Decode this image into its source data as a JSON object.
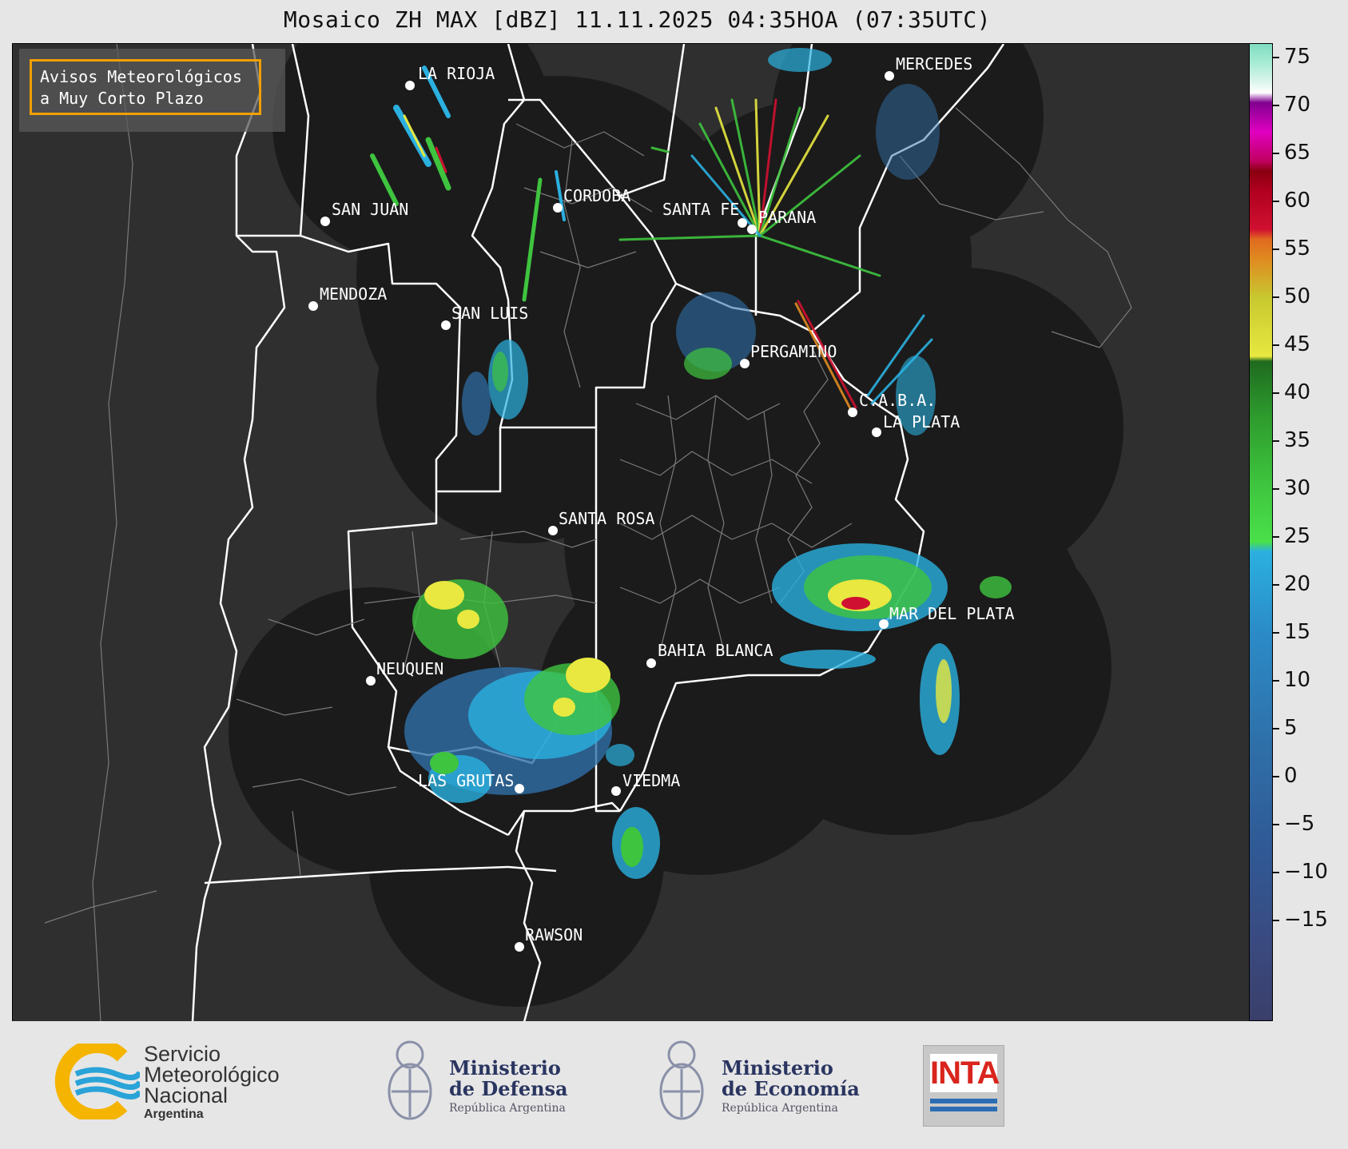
{
  "title": "Mosaico ZH MAX [dBZ] 11.11.2025 04:35HOA (07:35UTC)",
  "notice": {
    "line1": "Avisos Meteorológicos",
    "line2": "a Muy Corto Plazo"
  },
  "cities": [
    {
      "name": "LA RIOJA"
    },
    {
      "name": "MERCEDES"
    },
    {
      "name": "SAN JUAN"
    },
    {
      "name": "CORDOBA"
    },
    {
      "name": "SANTA FE"
    },
    {
      "name": "PARANA"
    },
    {
      "name": "MENDOZA"
    },
    {
      "name": "SAN LUIS"
    },
    {
      "name": "PERGAMINO"
    },
    {
      "name": "C.A.B.A."
    },
    {
      "name": "LA PLATA"
    },
    {
      "name": "SANTA ROSA"
    },
    {
      "name": "MAR DEL PLATA"
    },
    {
      "name": "BAHIA BLANCA"
    },
    {
      "name": "NEUQUEN"
    },
    {
      "name": "LAS GRUTAS"
    },
    {
      "name": "VIEDMA"
    },
    {
      "name": "RAWSON"
    }
  ],
  "colorbar": {
    "unit": "dBZ",
    "ticks": [
      "75",
      "70",
      "65",
      "60",
      "55",
      "50",
      "45",
      "40",
      "35",
      "30",
      "25",
      "20",
      "15",
      "10",
      "5",
      "0",
      "−5",
      "−10",
      "−15"
    ],
    "colors": {
      "below_20": "#3a3f6a",
      "blue_mid": "#2f6fa8",
      "cyan": "#2bb0e0",
      "green": "#3ec43e",
      "dark_green": "#1f6a1f",
      "yellow": "#e8e840",
      "orange": "#e08a20",
      "red": "#d01030",
      "dark_red": "#8a0010",
      "magenta": "#e000c0",
      "purple": "#800090",
      "white": "#ffffff",
      "mint": "#80dcc0"
    }
  },
  "footer": {
    "smn": {
      "line1": "Servicio",
      "line2": "Meteorológico",
      "line3": "Nacional",
      "line4": "Argentina"
    },
    "defensa": {
      "line1": "Ministerio",
      "line2": "de Defensa",
      "line3": "República Argentina"
    },
    "economia": {
      "line1": "Ministerio",
      "line2": "de Economía",
      "line3": "República Argentina"
    },
    "inta": {
      "label": "INTA"
    }
  }
}
